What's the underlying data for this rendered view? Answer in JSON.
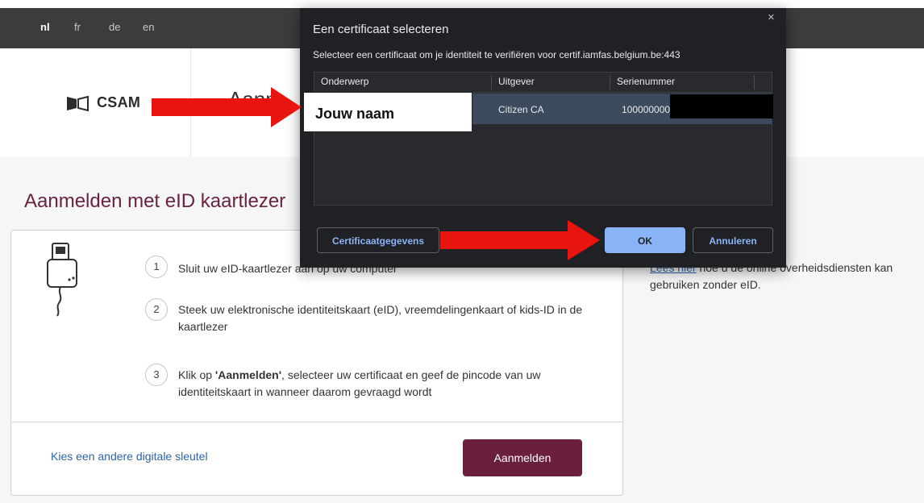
{
  "languages": [
    {
      "label": "nl",
      "active": true
    },
    {
      "label": "fr",
      "active": false
    },
    {
      "label": "de",
      "active": false
    },
    {
      "label": "en",
      "active": false
    }
  ],
  "header": {
    "logo_text": "CSAM",
    "page_title_partial": "Aanm"
  },
  "main": {
    "title": "Aanmelden met eID kaartlezer",
    "steps": [
      {
        "number": "1",
        "text": "Sluit uw eID-kaartlezer aan op uw computer"
      },
      {
        "number": "2",
        "text": "Steek uw elektronische identiteitskaart (eID), vreemdelingenkaart of kids-ID in de kaartlezer"
      },
      {
        "number": "3",
        "text_bold": "'Aanmelden'",
        "text_before": "Klik op ",
        "text_after": ", selecteer uw certificaat en geef de pincode van uw identiteitskaart in wanneer daarom gevraagd wordt"
      }
    ],
    "alt_key_link": "Kies een andere digitale sleutel",
    "login_button": "Aanmelden"
  },
  "side": {
    "link": "Lees hier",
    "text": " hoe u de online overheidsdiensten kan gebruiken zonder eID."
  },
  "dialog": {
    "title": "Een certificaat selecteren",
    "close": "×",
    "subtitle": "Selecteer een certificaat om je identiteit te verifiëren voor certif.iamfas.belgium.be:443",
    "columns": [
      "Onderwerp",
      "Uitgever",
      "Serienummer"
    ],
    "rows": [
      {
        "subject": "",
        "issuer": "Citizen CA",
        "serial": "100000000"
      }
    ],
    "details_button": "Certificaatgegevens",
    "ok_button": "OK",
    "cancel_button": "Annuleren"
  },
  "annotation": {
    "name_label": "Jouw naam"
  },
  "colors": {
    "brand": "#6b1f3e",
    "link": "#2f64a8",
    "arrow": "#e8140f",
    "dialog_bg": "#202124",
    "selected_row": "#3c4a5e",
    "ok_button": "#8ab4f8"
  }
}
